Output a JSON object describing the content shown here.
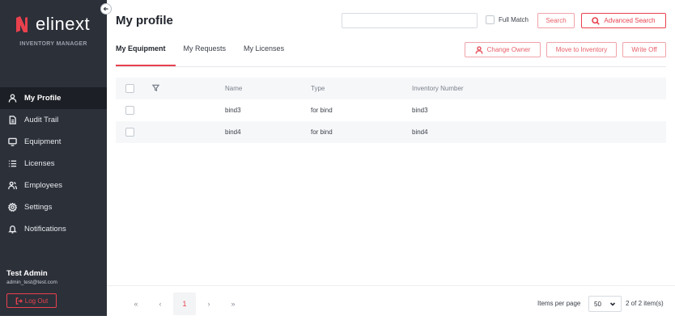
{
  "sidebar": {
    "logo_text": "elinext",
    "subtitle": "INVENTORY MANAGER",
    "items": [
      {
        "label": "My Profile",
        "icon": "user-icon",
        "active": true
      },
      {
        "label": "Audit Trail",
        "icon": "document-icon",
        "active": false
      },
      {
        "label": "Equipment",
        "icon": "monitor-icon",
        "active": false
      },
      {
        "label": "Licenses",
        "icon": "list-icon",
        "active": false
      },
      {
        "label": "Employees",
        "icon": "users-icon",
        "active": false
      },
      {
        "label": "Settings",
        "icon": "gear-icon",
        "active": false
      },
      {
        "label": "Notifications",
        "icon": "bell-icon",
        "active": false
      }
    ],
    "user_name": "Test Admin",
    "user_email": "admin_test@test.com",
    "logout_label": "Log Out"
  },
  "header": {
    "title": "My profile",
    "search_value": "",
    "full_match_label": "Full Match",
    "search_label": "Search",
    "advanced_search_label": "Advanced Search"
  },
  "tabs": [
    {
      "label": "My Equipment",
      "active": true
    },
    {
      "label": "My Requests",
      "active": false
    },
    {
      "label": "My Licenses",
      "active": false
    }
  ],
  "actions": {
    "change_owner": "Change Owner",
    "move_to_inventory": "Move to Inventory",
    "write_off": "Write Off"
  },
  "table": {
    "columns": [
      "Name",
      "Type",
      "Inventory Number"
    ],
    "rows": [
      {
        "name": "bind3",
        "type": "for bind",
        "inventory_number": "bind3"
      },
      {
        "name": "bind4",
        "type": "for bind",
        "inventory_number": "bind4"
      }
    ]
  },
  "footer": {
    "pages": [
      "«",
      "‹",
      "1",
      "›",
      "»"
    ],
    "items_per_page_label": "Items per page",
    "items_per_page_value": "50",
    "count_text": "2 of 2 item(s)"
  },
  "colors": {
    "accent": "#e8414d",
    "sidebar_bg": "#2c3039",
    "sidebar_active_bg": "#1c1f25"
  }
}
